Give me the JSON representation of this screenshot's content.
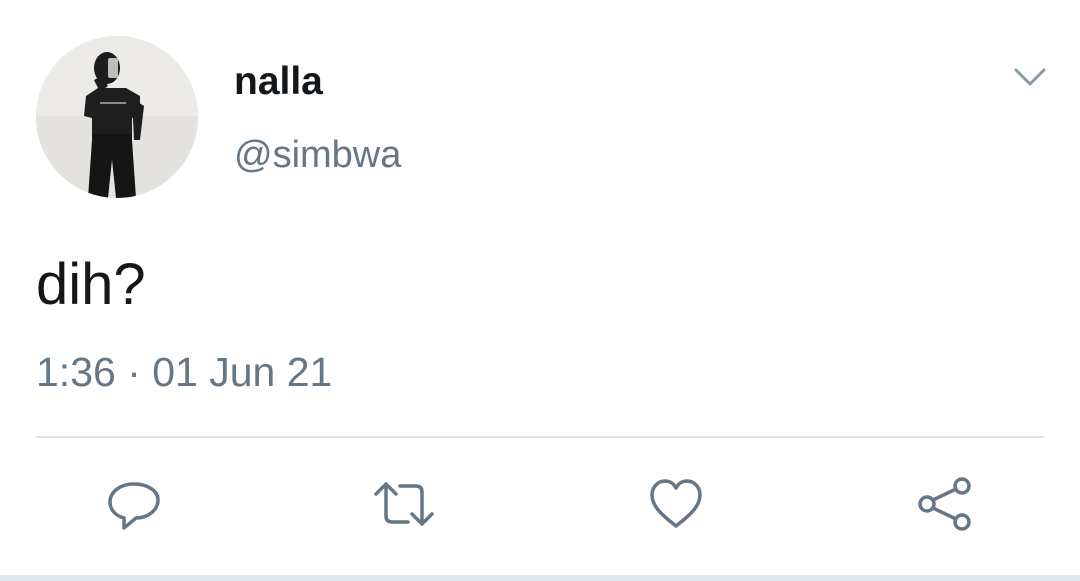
{
  "tweet": {
    "author": {
      "display_name": "nalla",
      "handle": "@simbwa"
    },
    "text": "dih?",
    "timestamp": "1:36 · 01 Jun 21"
  },
  "actions": [
    {
      "name": "reply",
      "icon": "reply-icon"
    },
    {
      "name": "retweet",
      "icon": "retweet-icon"
    },
    {
      "name": "like",
      "icon": "heart-icon"
    },
    {
      "name": "share",
      "icon": "share-icon"
    }
  ],
  "colors": {
    "text_primary": "#14171a",
    "text_secondary": "#657786",
    "icon": "#657786",
    "divider": "#dbe1e6",
    "background": "#ffffff"
  }
}
